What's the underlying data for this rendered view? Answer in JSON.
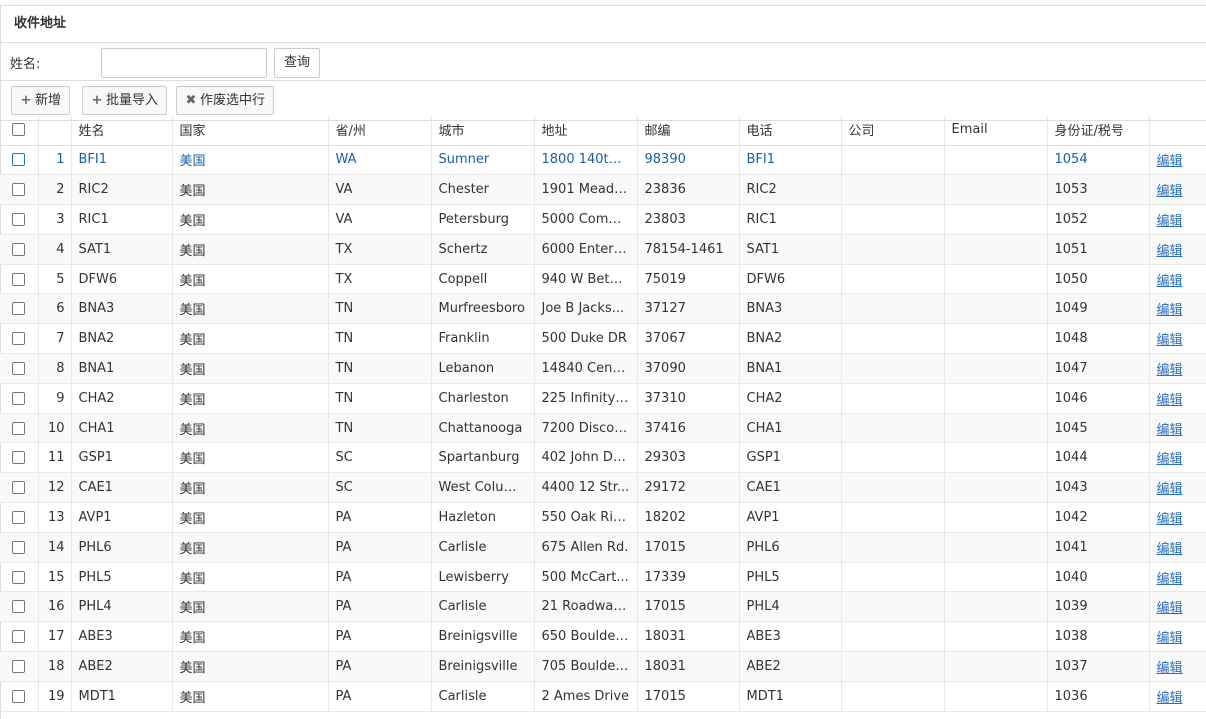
{
  "panel": {
    "title": "收件地址"
  },
  "search": {
    "label": "姓名:",
    "value": "",
    "placeholder": "",
    "button": "查询"
  },
  "toolbar": {
    "add": {
      "icon": "plus-icon",
      "label": "新增"
    },
    "import": {
      "icon": "plus-icon",
      "label": "批量导入"
    },
    "void": {
      "icon": "close-icon",
      "label": "作废选中行"
    }
  },
  "table": {
    "columns": [
      "",
      "",
      "姓名",
      "国家",
      "省/州",
      "城市",
      "地址",
      "邮编",
      "电话",
      "公司",
      "Email",
      "身份证/税号",
      ""
    ],
    "action_label": "编辑",
    "rows": [
      {
        "no": "1",
        "name": "BFI1",
        "country": "美国",
        "state": "WA",
        "city": "Sumner",
        "address": "1800 140th ...",
        "zip": "98390",
        "phone": "BFI1",
        "company": "",
        "email": "",
        "taxid": "1054",
        "selected": true
      },
      {
        "no": "2",
        "name": "RIC2",
        "country": "美国",
        "state": "VA",
        "city": "Chester",
        "address": "1901 Meado...",
        "zip": "23836",
        "phone": "RIC2",
        "company": "",
        "email": "",
        "taxid": "1053"
      },
      {
        "no": "3",
        "name": "RIC1",
        "country": "美国",
        "state": "VA",
        "city": "Petersburg",
        "address": "5000 Comm...",
        "zip": "23803",
        "phone": "RIC1",
        "company": "",
        "email": "",
        "taxid": "1052"
      },
      {
        "no": "4",
        "name": "SAT1",
        "country": "美国",
        "state": "TX",
        "city": "Schertz",
        "address": "6000 Enterp...",
        "zip": "78154-1461",
        "phone": "SAT1",
        "company": "",
        "email": "",
        "taxid": "1051"
      },
      {
        "no": "5",
        "name": "DFW6",
        "country": "美国",
        "state": "TX",
        "city": "Coppell",
        "address": "940 W Beth...",
        "zip": "75019",
        "phone": "DFW6",
        "company": "",
        "email": "",
        "taxid": "1050"
      },
      {
        "no": "6",
        "name": "BNA3",
        "country": "美国",
        "state": "TN",
        "city": "Murfreesboro",
        "address": "Joe B Jacks...",
        "zip": "37127",
        "phone": "BNA3",
        "company": "",
        "email": "",
        "taxid": "1049"
      },
      {
        "no": "7",
        "name": "BNA2",
        "country": "美国",
        "state": "TN",
        "city": "Franklin",
        "address": "500 Duke DR",
        "zip": "37067",
        "phone": "BNA2",
        "company": "",
        "email": "",
        "taxid": "1048"
      },
      {
        "no": "8",
        "name": "BNA1",
        "country": "美国",
        "state": "TN",
        "city": "Lebanon",
        "address": "14840 Centr...",
        "zip": "37090",
        "phone": "BNA1",
        "company": "",
        "email": "",
        "taxid": "1047"
      },
      {
        "no": "9",
        "name": "CHA2",
        "country": "美国",
        "state": "TN",
        "city": "Charleston",
        "address": "225 Infinity ...",
        "zip": "37310",
        "phone": "CHA2",
        "company": "",
        "email": "",
        "taxid": "1046"
      },
      {
        "no": "10",
        "name": "CHA1",
        "country": "美国",
        "state": "TN",
        "city": "Chattanooga",
        "address": "7200 Discov...",
        "zip": "37416",
        "phone": "CHA1",
        "company": "",
        "email": "",
        "taxid": "1045"
      },
      {
        "no": "11",
        "name": "GSP1",
        "country": "美国",
        "state": "SC",
        "city": "Spartanburg",
        "address": "402 John Do...",
        "zip": "29303",
        "phone": "GSP1",
        "company": "",
        "email": "",
        "taxid": "1044"
      },
      {
        "no": "12",
        "name": "CAE1",
        "country": "美国",
        "state": "SC",
        "city": "West Colum...",
        "address": "4400 12 Str...",
        "zip": "29172",
        "phone": "CAE1",
        "company": "",
        "email": "",
        "taxid": "1043"
      },
      {
        "no": "13",
        "name": "AVP1",
        "country": "美国",
        "state": "PA",
        "city": "Hazleton",
        "address": "550 Oak Rid...",
        "zip": "18202",
        "phone": "AVP1",
        "company": "",
        "email": "",
        "taxid": "1042"
      },
      {
        "no": "14",
        "name": "PHL6",
        "country": "美国",
        "state": "PA",
        "city": "Carlisle",
        "address": "675 Allen Rd.",
        "zip": "17015",
        "phone": "PHL6",
        "company": "",
        "email": "",
        "taxid": "1041"
      },
      {
        "no": "15",
        "name": "PHL5",
        "country": "美国",
        "state": "PA",
        "city": "Lewisberry",
        "address": "500 McCart...",
        "zip": "17339",
        "phone": "PHL5",
        "company": "",
        "email": "",
        "taxid": "1040"
      },
      {
        "no": "16",
        "name": "PHL4",
        "country": "美国",
        "state": "PA",
        "city": "Carlisle",
        "address": "21 Roadway...",
        "zip": "17015",
        "phone": "PHL4",
        "company": "",
        "email": "",
        "taxid": "1039"
      },
      {
        "no": "17",
        "name": "ABE3",
        "country": "美国",
        "state": "PA",
        "city": "Breinigsville",
        "address": "650 Boulder ...",
        "zip": "18031",
        "phone": "ABE3",
        "company": "",
        "email": "",
        "taxid": "1038"
      },
      {
        "no": "18",
        "name": "ABE2",
        "country": "美国",
        "state": "PA",
        "city": "Breinigsville",
        "address": "705 Boulder ...",
        "zip": "18031",
        "phone": "ABE2",
        "company": "",
        "email": "",
        "taxid": "1037"
      },
      {
        "no": "19",
        "name": "MDT1",
        "country": "美国",
        "state": "PA",
        "city": "Carlisle",
        "address": "2 Ames Drive",
        "zip": "17015",
        "phone": "MDT1",
        "company": "",
        "email": "",
        "taxid": "1036"
      }
    ]
  }
}
